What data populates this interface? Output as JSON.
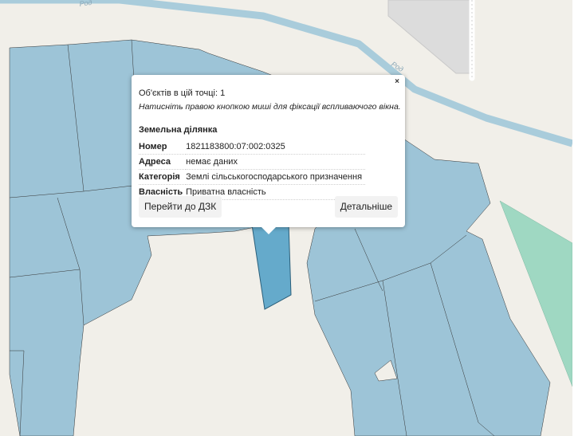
{
  "map": {
    "road_label_left": "Род",
    "road_label_right": "Род",
    "colors": {
      "background": "#f1efe9",
      "parcel": "#9dc4d7",
      "parcel_selected": "#65aacb",
      "parcel_green": "#9fd8c2",
      "river": "#a9ccdb",
      "building": "#dcdcdc"
    }
  },
  "popup": {
    "close": "×",
    "objects_count": "Об'єктів в цій точці: 1",
    "hint": "Натисніть правою кнопкою миші для фіксації вспливаючого вікна.",
    "section_title": "Земельна ділянка",
    "rows": [
      {
        "key": "Номер",
        "value": "1821183800:07:002:0325"
      },
      {
        "key": "Адреса",
        "value": "немає даних"
      },
      {
        "key": "Категорія",
        "value": "Землі сільськогосподарського призначення"
      },
      {
        "key": "Власність",
        "value": "Приватна власність"
      }
    ],
    "btn_dzk": "Перейти до ДЗК",
    "btn_details": "Детальніше"
  }
}
